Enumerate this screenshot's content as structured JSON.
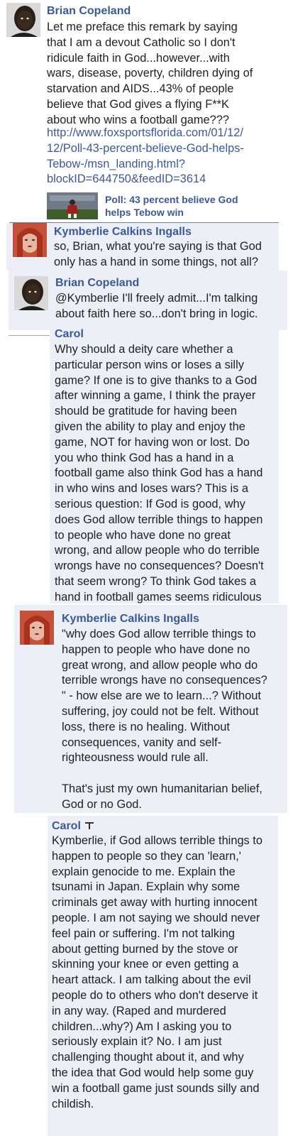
{
  "comments": [
    {
      "author": "Brian Copeland",
      "text": "Let me preface this remark by saying\nthat I am a devout Catholic so I don't\nridicule faith in God...however...with\nwars, disease, poverty, children dying of\nstarvation and AIDS...43% of people\nbelieve that God gives a flying F**K\nabout who wins a football game???",
      "link": "http://www.foxsportsflorida.com/01/12/\n12/Poll-43-percent-believe-God-helps-\nTebow-/msn_landing.html?\nblockID=644750&feedID=3614",
      "share_title": "Poll: 43 percent believe God\nhelps Tebow win",
      "share_icon": "football-photo-thumbnail"
    },
    {
      "author": "Kymberlie Calkins Ingalls",
      "text": "so, Brian, what you're saying is that God\nonly has a hand in some things, not all?"
    },
    {
      "author": "Brian Copeland",
      "text": "@Kymberlie I'll freely admit...I'm talking\nabout faith here so...don't bring in logic."
    },
    {
      "author": "Carol",
      "text": "Why should a deity care whether a\nparticular person wins or loses a silly\ngame? If one is to give thanks to a God\nafter winning a game, I think the prayer\nshould be gratitude for having been\ngiven the ability to play and enjoy the\ngame, NOT for having won or lost. Do\nyou who think God has a hand in a\nfootball game also think God has a hand\nin who wins and loses wars? This is a\nserious question: If God is good, why\ndoes God allow terrible things to happen\nto people who have done no great\nwrong, and allow people who do terrible\nwrongs have no consequences? Doesn't\nthat seem wrong? To think God takes a\nhand in football games seems ridiculous"
    },
    {
      "author": "Kymberlie Calkins Ingalls",
      "text": "\"why does God allow terrible things to\nhappen to people who have done no\ngreat wrong, and allow people who do\nterrible wrongs have no consequences?\n\" - how else are we to learn...? Without\nsuffering, joy could not be felt. Without\nloss, there is no healing. Without\nconsequences, vanity and self-\nrighteousness would rule all.\n\nThat's just my own humanitarian belief,\nGod or no God."
    },
    {
      "author": "Carol",
      "text": "Kymberlie, if God allows terrible things to\nhappen to people so they can 'learn,'\nexplain genocide to me. Explain the\ntsunami in Japan. Explain why some\ncriminals get away with hurting innocent\npeople. I am not saying we should never\nfeel pain or suffering. I'm not talking\nabout getting burned by the stove or\nskinning your knee or even getting a\nheart attack. I am talking about the evil\npeople do to others who don't deserve it\nin any way. (Raped and murdered\nchildren...why?) Am I asking you to\nseriously explain it? No. I am just\nchallenging thought about it, and why\nthe idea that God would help some guy\nwin a football game just sounds silly and\nchildish."
    }
  ],
  "avatars": {
    "brian": "profile-photo-dark",
    "kymberlie": "profile-photo-red-hair"
  },
  "colors": {
    "name": "#3b5998",
    "text": "#222222",
    "panel": "#eceff5",
    "divider": "#9aa6c2"
  }
}
